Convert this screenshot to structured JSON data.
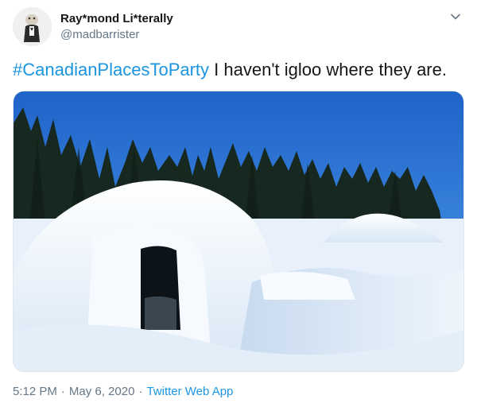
{
  "tweet": {
    "author": {
      "display_name": "Ray*mond Li*terally",
      "handle": "@madbarrister"
    },
    "text": {
      "hashtag": "#CanadianPlacesToParty",
      "body": " I haven't igloo where they are."
    },
    "meta": {
      "time": "5:12 PM",
      "separator": "·",
      "date": "May 6, 2020",
      "source": "Twitter Web App"
    },
    "colors": {
      "link": "#1b95e0",
      "secondary_text": "#657786",
      "primary_text": "#14171a"
    },
    "icons": {
      "caret": "chevron-down-icon"
    }
  }
}
